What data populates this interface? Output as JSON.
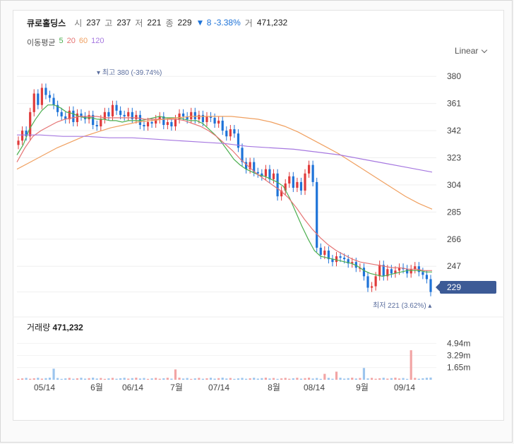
{
  "header": {
    "name": "큐로홀딩스",
    "open_label": "시",
    "open": "237",
    "high_label": "고",
    "high": "237",
    "low_label": "저",
    "low": "221",
    "close_label": "종",
    "close": "229",
    "change": "▼ 8 -3.38%",
    "volume_label": "거",
    "volume": "471,232"
  },
  "ma_legend": {
    "label": "이동평균",
    "items": [
      {
        "text": "5",
        "color": "#4caf50"
      },
      {
        "text": "20",
        "color": "#e57373"
      },
      {
        "text": "60",
        "color": "#f0a060"
      },
      {
        "text": "120",
        "color": "#a678e0"
      }
    ]
  },
  "scale_selector": "Linear",
  "price_tag": "229",
  "volume_title": {
    "label": "거래량",
    "value": "471,232"
  },
  "colors": {
    "up": "#e03b3b",
    "down": "#1e73d8",
    "ma5": "#4caf50",
    "ma20": "#e57373",
    "ma60": "#f0a060",
    "ma120": "#a678e0",
    "vol_up": "#f2a5a5",
    "vol_down": "#9cc5ee"
  },
  "chart_data": {
    "type": "line",
    "price_axis": {
      "ticks": [
        380,
        361,
        342,
        323,
        304,
        285,
        266,
        247,
        229
      ],
      "ylim": [
        213,
        391
      ]
    },
    "volume_axis": {
      "ticks": [
        "4.94m",
        "3.29m",
        "1.65m"
      ],
      "ylim": [
        0,
        6.5
      ]
    },
    "x_labels": [
      "05/14",
      "6월",
      "06/14",
      "7월",
      "07/14",
      "8월",
      "08/14",
      "9월",
      "09/14"
    ],
    "annotations": {
      "high": {
        "text": "최고 380 (-39.74%)",
        "value": 380
      },
      "low": {
        "text": "최저 221 (3.62%)",
        "value": 221
      }
    },
    "candles_close": [
      335,
      342,
      338,
      355,
      368,
      360,
      372,
      367,
      365,
      360,
      355,
      352,
      350,
      356,
      348,
      354,
      352,
      350,
      353,
      346,
      345,
      350,
      355,
      352,
      360,
      356,
      353,
      352,
      355,
      350,
      353,
      346,
      345,
      348,
      347,
      350,
      352,
      346,
      348,
      345,
      350,
      354,
      352,
      350,
      355,
      350,
      353,
      348,
      352,
      351,
      347,
      349,
      342,
      338,
      343,
      340,
      330,
      320,
      315,
      320,
      313,
      312,
      310,
      315,
      308,
      312,
      296,
      300,
      305,
      310,
      302,
      306,
      300,
      312,
      318,
      306,
      260,
      255,
      258,
      252,
      250,
      254,
      253,
      252,
      249,
      250,
      246,
      246,
      240,
      232,
      233,
      240,
      248,
      240,
      245,
      242,
      244,
      246,
      245,
      242,
      245,
      247,
      243,
      241,
      238,
      229
    ],
    "ma_series": [
      {
        "name": "5",
        "values": [
          325,
          332,
          343,
          350,
          356,
          360,
          360,
          358,
          355,
          354,
          352,
          351,
          351,
          350,
          350,
          349,
          349,
          348,
          349,
          349,
          349,
          350,
          351,
          352,
          351,
          351,
          351,
          350,
          349,
          349,
          347,
          343,
          339,
          334,
          328,
          322,
          318,
          315,
          313,
          311,
          310,
          308,
          306,
          303,
          295,
          285,
          275,
          266,
          258,
          254,
          253,
          252,
          251,
          250,
          249,
          247,
          244,
          242,
          241,
          240,
          241,
          242,
          243,
          244,
          244,
          244,
          243,
          243
        ]
      },
      {
        "name": "20",
        "values": [
          320,
          330,
          338,
          342,
          345,
          348,
          350,
          351,
          352,
          352,
          352,
          351,
          351,
          351,
          351,
          351,
          350,
          350,
          350,
          350,
          350,
          349,
          347,
          345,
          342,
          338,
          333,
          328,
          322,
          317,
          312,
          308,
          304,
          300,
          295,
          288,
          280,
          273,
          267,
          262,
          258,
          255,
          252,
          250,
          249,
          248,
          247,
          246,
          246,
          245,
          245,
          244,
          244
        ]
      },
      {
        "name": "60",
        "values": [
          315,
          320,
          325,
          330,
          334,
          338,
          341,
          344,
          346,
          348,
          349,
          350,
          351,
          352,
          352,
          352,
          352,
          351,
          350,
          348,
          345,
          341,
          336,
          331,
          326,
          320,
          314,
          308,
          302,
          296,
          291,
          287
        ]
      },
      {
        "name": "120",
        "values": [
          339,
          339,
          338,
          338,
          337,
          337,
          336,
          335,
          334,
          333,
          331,
          330,
          329,
          327,
          325,
          322,
          319,
          316,
          313
        ]
      }
    ]
  }
}
